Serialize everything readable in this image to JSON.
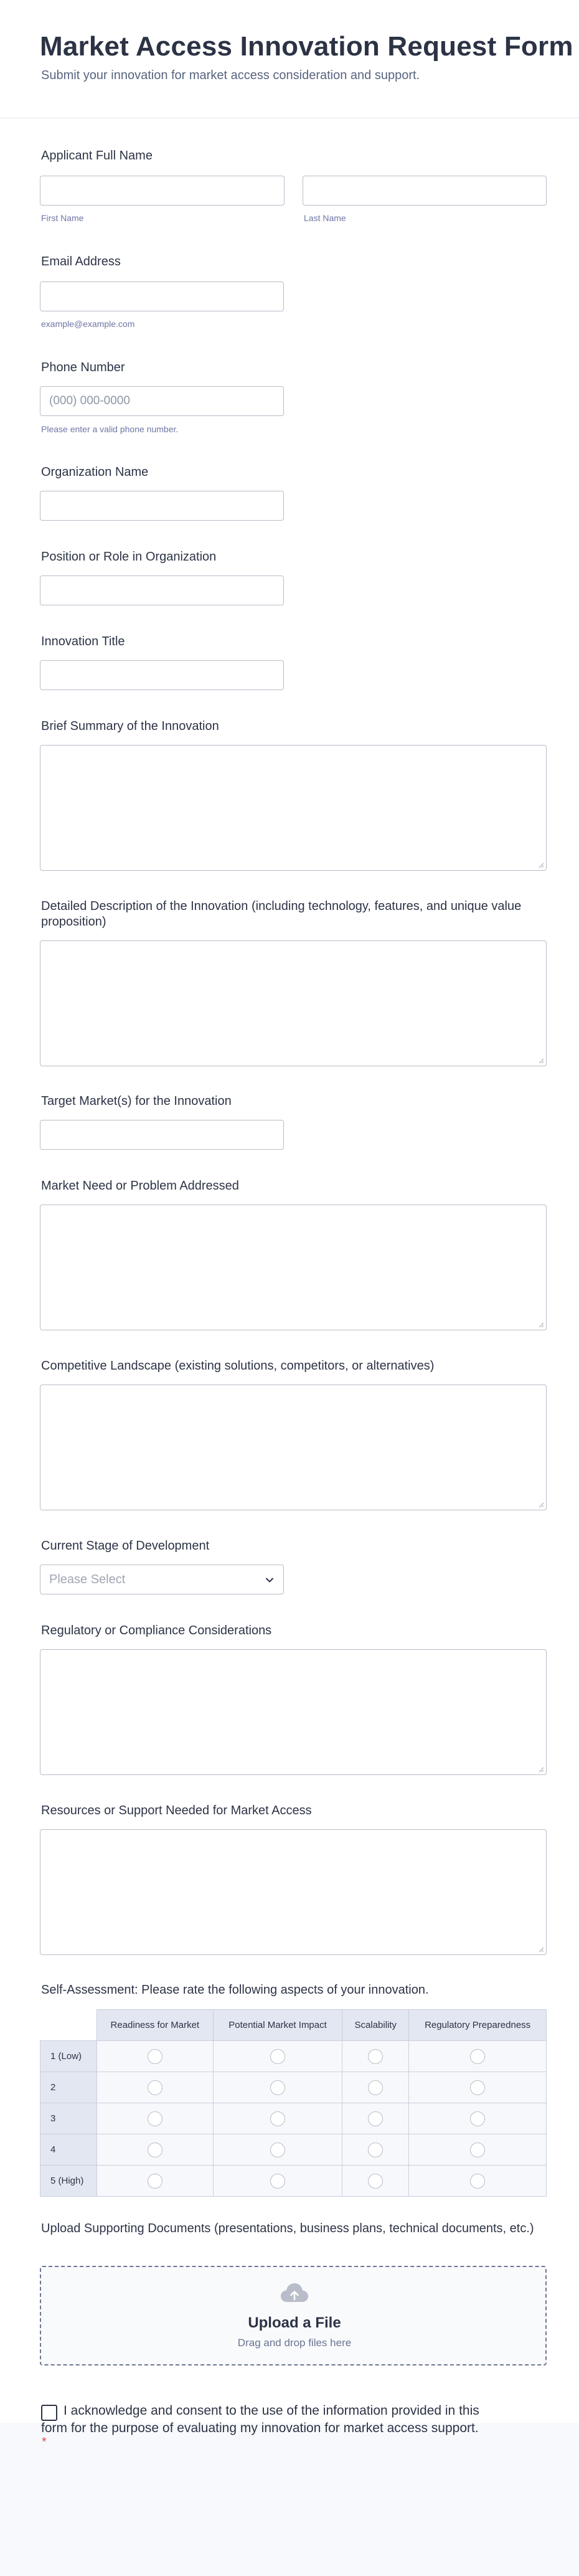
{
  "form": {
    "title": "Market Access Innovation Request Form",
    "subtitle": "Submit your innovation for market access consideration and support."
  },
  "fields": {
    "full_name": {
      "label": "Applicant Full Name",
      "first_sublabel": "First Name",
      "last_sublabel": "Last Name",
      "first_value": "",
      "last_value": ""
    },
    "email": {
      "label": "Email Address",
      "sublabel": "example@example.com",
      "value": ""
    },
    "phone": {
      "label": "Phone Number",
      "placeholder": "(000) 000-0000",
      "sublabel": "Please enter a valid phone number.",
      "value": ""
    },
    "organization": {
      "label": "Organization Name",
      "value": ""
    },
    "position": {
      "label": "Position or Role in Organization",
      "value": ""
    },
    "innovation_title": {
      "label": "Innovation Title",
      "value": ""
    },
    "summary": {
      "label": "Brief Summary of the Innovation",
      "value": ""
    },
    "description": {
      "label": "Detailed Description of the Innovation (including technology, features, and unique value proposition)",
      "value": ""
    },
    "target_markets": {
      "label": "Target Market(s) for the Innovation",
      "value": ""
    },
    "market_need": {
      "label": "Market Need or Problem Addressed",
      "value": ""
    },
    "competitive": {
      "label": "Competitive Landscape (existing solutions, competitors, or alternatives)",
      "value": ""
    },
    "stage": {
      "label": "Current Stage of Development",
      "placeholder": "Please Select",
      "selected": ""
    },
    "regulatory": {
      "label": "Regulatory or Compliance Considerations",
      "value": ""
    },
    "resources": {
      "label": "Resources or Support Needed for Market Access",
      "value": ""
    }
  },
  "self_assessment": {
    "label": "Self-Assessment: Please rate the following aspects of your innovation.",
    "columns": [
      "Readiness for Market",
      "Potential Market Impact",
      "Scalability",
      "Regulatory Preparedness"
    ],
    "rows": [
      "1 (Low)",
      "2",
      "3",
      "4",
      "5 (High)"
    ]
  },
  "upload": {
    "label": "Upload Supporting Documents (presentations, business plans, technical documents, etc.)",
    "title": "Upload a File",
    "subtitle": "Drag and drop files here"
  },
  "consent": {
    "text": "I acknowledge and consent to the use of the information provided in this form for the purpose of evaluating my innovation for market access support.",
    "required_mark": "*",
    "checked": false
  },
  "colors": {
    "text": "#2c3345",
    "muted": "#57647e",
    "border": "#b8bdc9",
    "table_header": "#e3e7f2",
    "required": "#e44e4e"
  },
  "icons": {
    "select": "chevron-down-icon",
    "upload": "cloud-upload-icon",
    "textarea_grip": "resize-grip-icon"
  }
}
